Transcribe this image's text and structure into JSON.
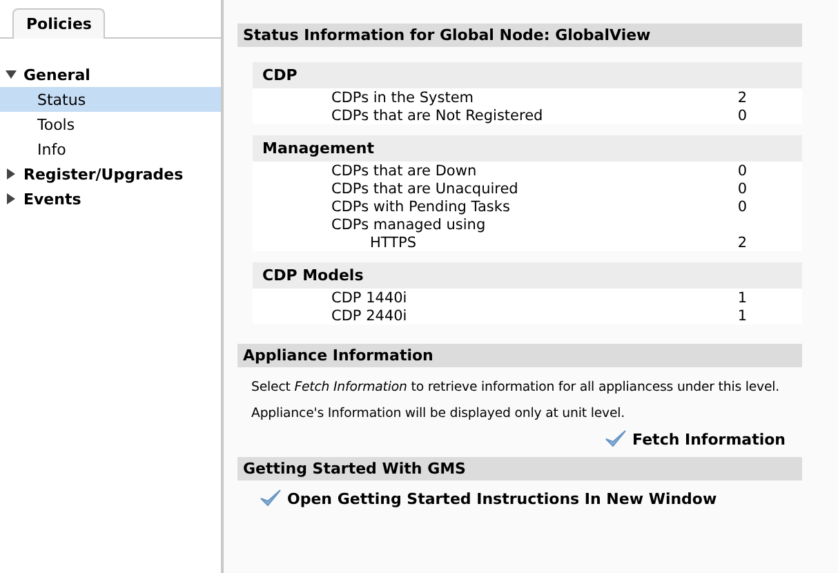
{
  "sidebar": {
    "tab": {
      "label": "Policies",
      "selected": true
    },
    "tree": [
      {
        "label": "General",
        "expanded": true,
        "children": [
          {
            "label": "Status",
            "selected": true
          },
          {
            "label": "Tools",
            "selected": false
          },
          {
            "label": "Info",
            "selected": false
          }
        ]
      },
      {
        "label": "Register/Upgrades",
        "expanded": false
      },
      {
        "label": "Events",
        "expanded": false
      }
    ]
  },
  "status": {
    "title": "Status Information for Global Node: GlobalView",
    "groups": [
      {
        "title": "CDP",
        "rows": [
          {
            "label": "CDPs in the System",
            "value": "2"
          },
          {
            "label": "CDPs that are Not Registered",
            "value": "0"
          }
        ]
      },
      {
        "title": "Management",
        "rows": [
          {
            "label": "CDPs that are Down",
            "value": "0"
          },
          {
            "label": "CDPs that are Unacquired",
            "value": "0"
          },
          {
            "label": "CDPs with Pending Tasks",
            "value": "0"
          },
          {
            "label": "CDPs managed using",
            "children": [
              {
                "label": "HTTPS",
                "value": "2"
              }
            ]
          }
        ]
      },
      {
        "title": "CDP Models",
        "rows": [
          {
            "label": "CDP 1440i",
            "value": "1"
          },
          {
            "label": "CDP 2440i",
            "value": "1"
          }
        ]
      }
    ]
  },
  "appliance": {
    "title": "Appliance Information",
    "lines": [
      "Select *Fetch Information* to retrieve information for all appliancess under this level.",
      "Appliance's Information will be displayed only at unit level."
    ],
    "action": "Fetch Information"
  },
  "getting_started": {
    "title": "Getting Started With GMS",
    "action": "Open Getting Started Instructions In New Window"
  }
}
